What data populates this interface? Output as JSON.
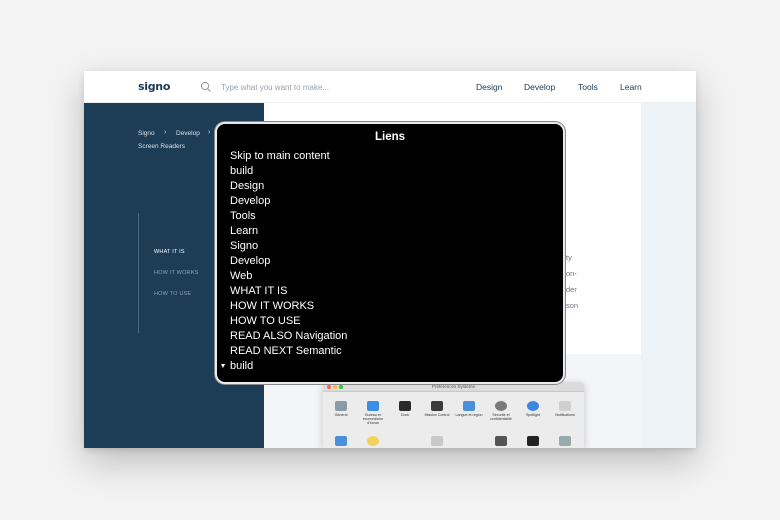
{
  "header": {
    "logo": "signo",
    "search_placeholder": "Type what you want to make...",
    "nav": [
      "Design",
      "Develop",
      "Tools",
      "Learn"
    ]
  },
  "sidebar": {
    "breadcrumb": [
      "Signo",
      "Develop",
      "Screen Readers"
    ],
    "toc": [
      "WHAT IT IS",
      "HOW IT WORKS",
      "HOW TO USE"
    ]
  },
  "content_fragments": [
    "ty",
    "on-",
    "der",
    "son"
  ],
  "preferences": {
    "title": "Préférences Système",
    "icons": [
      "Général",
      "Bureau et économiseur d'écran",
      "Dock",
      "Mission Control",
      "Langue et région",
      "Sécurité et confidentialité",
      "Spotlight",
      "Notifications"
    ]
  },
  "overlay": {
    "title": "Liens",
    "links": [
      "Skip to main content",
      "build",
      "Design",
      "Develop",
      "Tools",
      "Learn",
      "Signo",
      "Develop",
      "Web",
      "WHAT IT IS",
      "HOW IT WORKS",
      "HOW TO USE",
      "READ ALSO Navigation",
      "READ NEXT Semantic",
      "build"
    ]
  },
  "colors": {
    "sidebar_bg": "#1d3c56",
    "brand_text": "#1c3a56",
    "overlay_bg": "#000000"
  }
}
